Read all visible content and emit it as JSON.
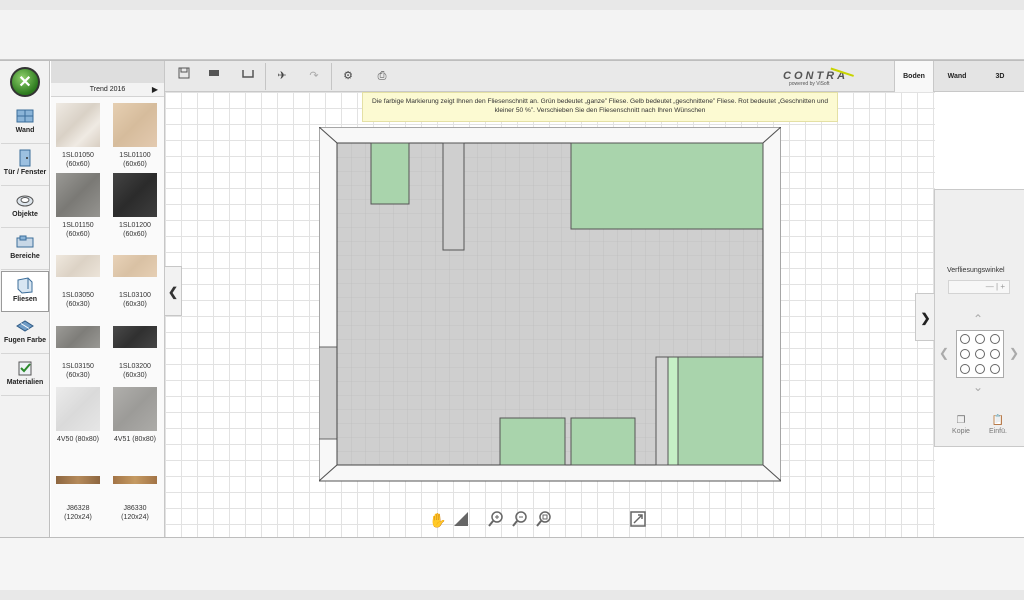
{
  "nav": [
    {
      "label": "Wand",
      "icon": "wall-icon"
    },
    {
      "label": "Tür / Fenster",
      "icon": "door-window-icon"
    },
    {
      "label": "Objekte",
      "icon": "objects-icon"
    },
    {
      "label": "Bereiche",
      "icon": "areas-icon"
    },
    {
      "label": "Fliesen",
      "icon": "tiles-icon",
      "active": true
    },
    {
      "label": "Fugen Farbe",
      "icon": "grout-color-icon"
    },
    {
      "label": "Materialien",
      "icon": "materials-icon"
    }
  ],
  "panel": {
    "title": "Trend 2016",
    "tiles": [
      {
        "code": "1SL01050",
        "size": "(60x60)",
        "color": "#e6e0d8"
      },
      {
        "code": "1SL01100",
        "size": "(60x60)",
        "color": "#dcc4a8"
      },
      {
        "code": "1SL01150",
        "size": "(60x60)",
        "color": "#8b8a86"
      },
      {
        "code": "1SL01200",
        "size": "(60x60)",
        "color": "#3a3a3a"
      },
      {
        "code": "1SL03050",
        "size": "(60x30)",
        "color": "#e8e0d6"
      },
      {
        "code": "1SL03100",
        "size": "(60x30)",
        "color": "#dfc8ae"
      },
      {
        "code": "1SL03150",
        "size": "(60x30)",
        "color": "#8f8e8a"
      },
      {
        "code": "1SL03200",
        "size": "(60x30)",
        "color": "#444444"
      },
      {
        "code": "4V50 (80x80)",
        "size": "",
        "color": "#e4e4e4"
      },
      {
        "code": "4V51 (80x80)",
        "size": "",
        "color": "#a8a7a4"
      },
      {
        "code": "J86328 (120x24)",
        "size": "",
        "color": "#a57a4e"
      },
      {
        "code": "J86330 (120x24)",
        "size": "",
        "color": "#b08452"
      }
    ]
  },
  "toolbar": {
    "brand": "CONTRA",
    "brand_sub": "powered by ViSoft"
  },
  "view_tabs": [
    {
      "label": "Boden",
      "active": true
    },
    {
      "label": "Wand"
    },
    {
      "label": "3D"
    }
  ],
  "hint": "Die farbige Markierung zeigt Ihnen den Fliesenschnitt an. Grün bedeutet „ganze” Fliese. Gelb bedeutet „geschnittene” Fliese. Rot bedeutet „Geschnitten und kleiner 50 %”. Verschieben Sie den Fliesenschnitt nach Ihren Wünschen",
  "right_panel": {
    "angle_label": "Verfliesungswinkel",
    "angle_controls": "— | +",
    "copy_label": "Kopie",
    "paste_label": "Einfü."
  },
  "colors": {
    "tile_green": "#a9d4ac",
    "tile_green_light": "#c5f0c5",
    "floor_gray": "#cfcfcf",
    "wall_white": "#f8f8f8",
    "accent_green": "#2c7a1e"
  }
}
